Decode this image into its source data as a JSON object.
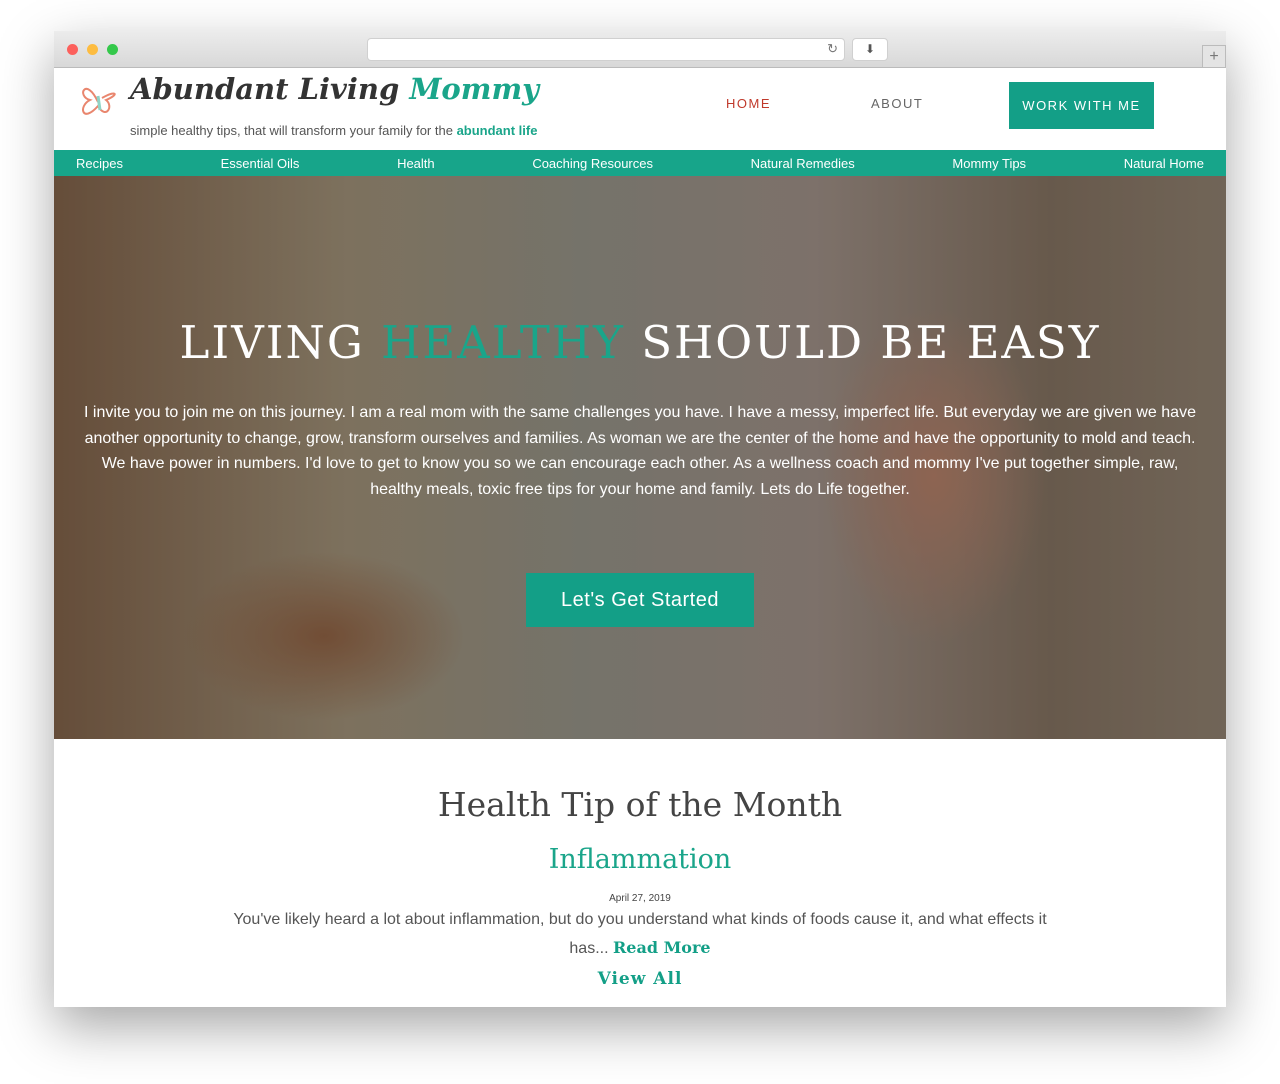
{
  "browser": {
    "reload_icon": "reload-icon",
    "download_icon": "download-icon"
  },
  "header": {
    "logo_title_1": "Abundant Living ",
    "logo_title_2": "Mommy",
    "tagline": "simple healthy tips, that will transform your family for the ",
    "tagline_highlight": "abundant life",
    "nav": {
      "home": "HOME",
      "about": "ABOUT",
      "work": "WORK WITH ME"
    },
    "colors": {
      "accent": "#17a58a",
      "active": "#c0392b"
    }
  },
  "menu": [
    "Recipes",
    "Essential Oils",
    "Health",
    "Coaching Resources",
    "Natural Remedies",
    "Mommy Tips",
    "Natural Home"
  ],
  "hero": {
    "title_1": "LIVING ",
    "title_highlight": "HEALTHY",
    "title_2": " SHOULD BE EASY",
    "text": "I invite you to join me on this journey. I am a real mom with the same challenges you have. I have a messy, imperfect life. But everyday we are given we have another opportunity to change, grow, transform ourselves and families. As woman we are the center of the home and have the opportunity to mold and teach. We have power in numbers. I'd love to get to know you so we can encourage each other. As a wellness coach and mommy I've put together simple, raw, healthy meals, toxic free tips for your home and family. Lets do Life together.",
    "cta": "Let's Get Started"
  },
  "tip": {
    "heading": "Health Tip of the Month",
    "title": "Inflammation",
    "date": "April 27, 2019",
    "excerpt": "You've likely heard a lot about inflammation, but do you understand what kinds of foods cause it, and what effects it has... ",
    "read_more": "Read More",
    "view_all": "View All"
  }
}
